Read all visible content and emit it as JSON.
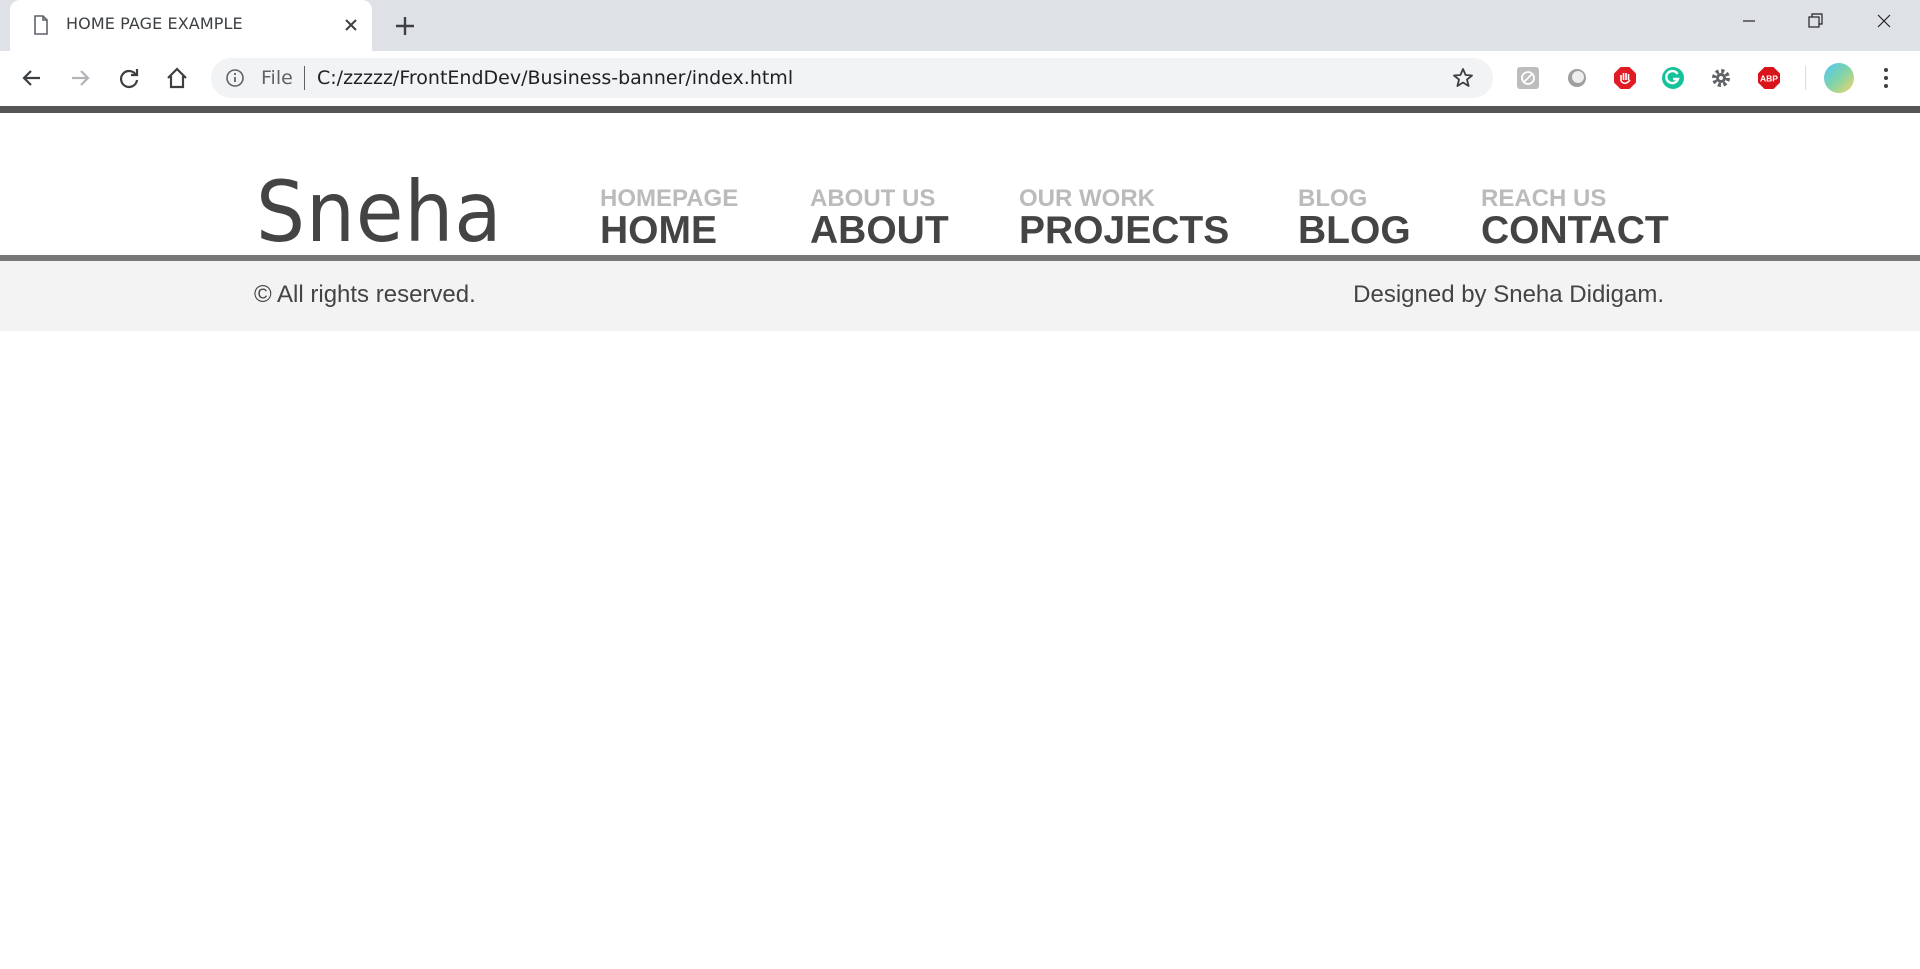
{
  "browser": {
    "tab_title": "HOME PAGE EXAMPLE",
    "scheme_label": "File",
    "url": "C:/zzzzz/FrontEndDev/Business-banner/index.html",
    "extensions": [
      "ghostery-icon",
      "disconnect-icon",
      "adblock-stop-icon",
      "grammarly-icon",
      "settings-gear-icon",
      "adblock-plus-icon"
    ],
    "abp_label": "ABP"
  },
  "site": {
    "logo": "Sneha",
    "nav": [
      {
        "sub": "HOMEPAGE",
        "main": "HOME"
      },
      {
        "sub": "ABOUT US",
        "main": "ABOUT"
      },
      {
        "sub": "OUR WORK",
        "main": "PROJECTS"
      },
      {
        "sub": "BLOG",
        "main": "BLOG"
      },
      {
        "sub": "REACH US",
        "main": "CONTACT"
      }
    ],
    "footer": {
      "copyright": "© All rights reserved.",
      "credit": "Designed by Sneha Didigam."
    },
    "colors": {
      "dark_text": "#444444",
      "light_text": "#bbbbbb",
      "footer_bg": "#f3f3f3",
      "border": "#555555"
    }
  }
}
